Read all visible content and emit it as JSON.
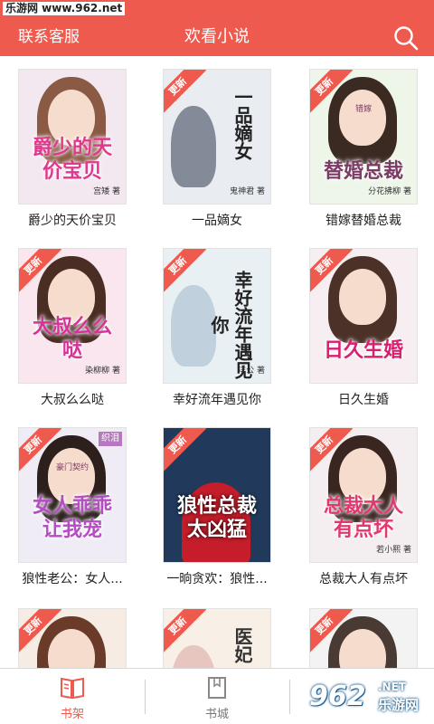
{
  "statusbar": {
    "watermark": "乐游网 www.962.net"
  },
  "appbar": {
    "left_label": "联系客服",
    "title": "欢看小说",
    "search_icon": "search-icon",
    "color": "#ef5a4e"
  },
  "ribbon_label": "更新",
  "books": [
    {
      "name": "爵少的天价宝贝",
      "cover_title": "爵少的天价宝贝",
      "cover_author": "宫矮 著",
      "ribbon": false,
      "style": "girl",
      "bg": "#f3e8f0",
      "hair": "#8a5a44",
      "title_color": "#e0388d"
    },
    {
      "name": "一品嫡女",
      "cover_title": "一品嫡女",
      "cover_author": "鬼神君 著",
      "ribbon": true,
      "style": "vertical",
      "bg": "#e9edf2",
      "hair": "#2f3a4f",
      "title_color": "#222222"
    },
    {
      "name": "错嫁替婚总裁",
      "cover_title": "替婚总裁",
      "cover_sub": "错嫁",
      "cover_author": "分花拂柳 著",
      "ribbon": true,
      "style": "girl",
      "bg": "#eef6ea",
      "hair": "#3b2a22",
      "title_color": "#7c3b65"
    },
    {
      "name": "大叔么么哒",
      "cover_title": "大叔么么哒",
      "cover_author": "染柳柳 著",
      "ribbon": true,
      "style": "girl",
      "bg": "#f9e6ee",
      "hair": "#4a2e24",
      "title_color": "#d7319a"
    },
    {
      "name": "幸好流年遇见你",
      "cover_title": "幸好流年遇见你",
      "cover_author": "洋公 著",
      "ribbon": true,
      "style": "vertical",
      "bg": "#e8f0f4",
      "hair": "#9fb7c8",
      "title_color": "#222222"
    },
    {
      "name": "日久生婚",
      "cover_title": "日久生婚",
      "cover_author": "",
      "ribbon": true,
      "style": "girl",
      "bg": "#f6eef0",
      "hair": "#4b3128",
      "title_color": "#d81f6f"
    },
    {
      "name": "狼性老公：女人...",
      "cover_title": "女人乖乖让我宠",
      "cover_sub": "豪门契约",
      "cover_author": "",
      "ribbon": true,
      "badge": "织泪",
      "style": "girl",
      "bg": "#f0ecf6",
      "hair": "#2c1f1c",
      "title_color": "#b44cc2"
    },
    {
      "name": "一晌贪欢：狼性...",
      "cover_title": "狼性总裁太凶猛",
      "cover_author": "",
      "ribbon": true,
      "style": "dark",
      "bg": "#213a5c",
      "hair": "#c51d2a",
      "title_color": "#ffffff"
    },
    {
      "name": "总裁大人有点坏",
      "cover_title": "总裁大人有点坏",
      "cover_author": "若小熙 著",
      "ribbon": true,
      "style": "girl",
      "bg": "#f5eef0",
      "hair": "#3a2620",
      "title_color": "#e0386f"
    },
    {
      "name": "",
      "cover_title": "",
      "cover_author": "",
      "ribbon": true,
      "style": "girl",
      "bg": "#f7ece4",
      "hair": "#6b3b2a",
      "title_color": "#333333"
    },
    {
      "name": "",
      "cover_title": "医妃",
      "cover_author": "",
      "ribbon": true,
      "style": "vertical",
      "bg": "#f8efe6",
      "hair": "#d9a4a0",
      "title_color": "#333333"
    },
    {
      "name": "",
      "cover_title": "",
      "cover_author": "",
      "ribbon": true,
      "style": "girl",
      "bg": "#f3f3f3",
      "hair": "#4a3a34",
      "title_color": "#333333"
    }
  ],
  "tabbar": {
    "tabs": [
      {
        "label": "书架",
        "icon": "book-open-icon",
        "active": true
      },
      {
        "label": "书城",
        "icon": "bookmark-book-icon",
        "active": false
      },
      {
        "label": "",
        "icon": "",
        "active": false
      }
    ]
  },
  "watermark": {
    "logo": "962",
    "net": ".NET",
    "cn": "乐游网"
  }
}
